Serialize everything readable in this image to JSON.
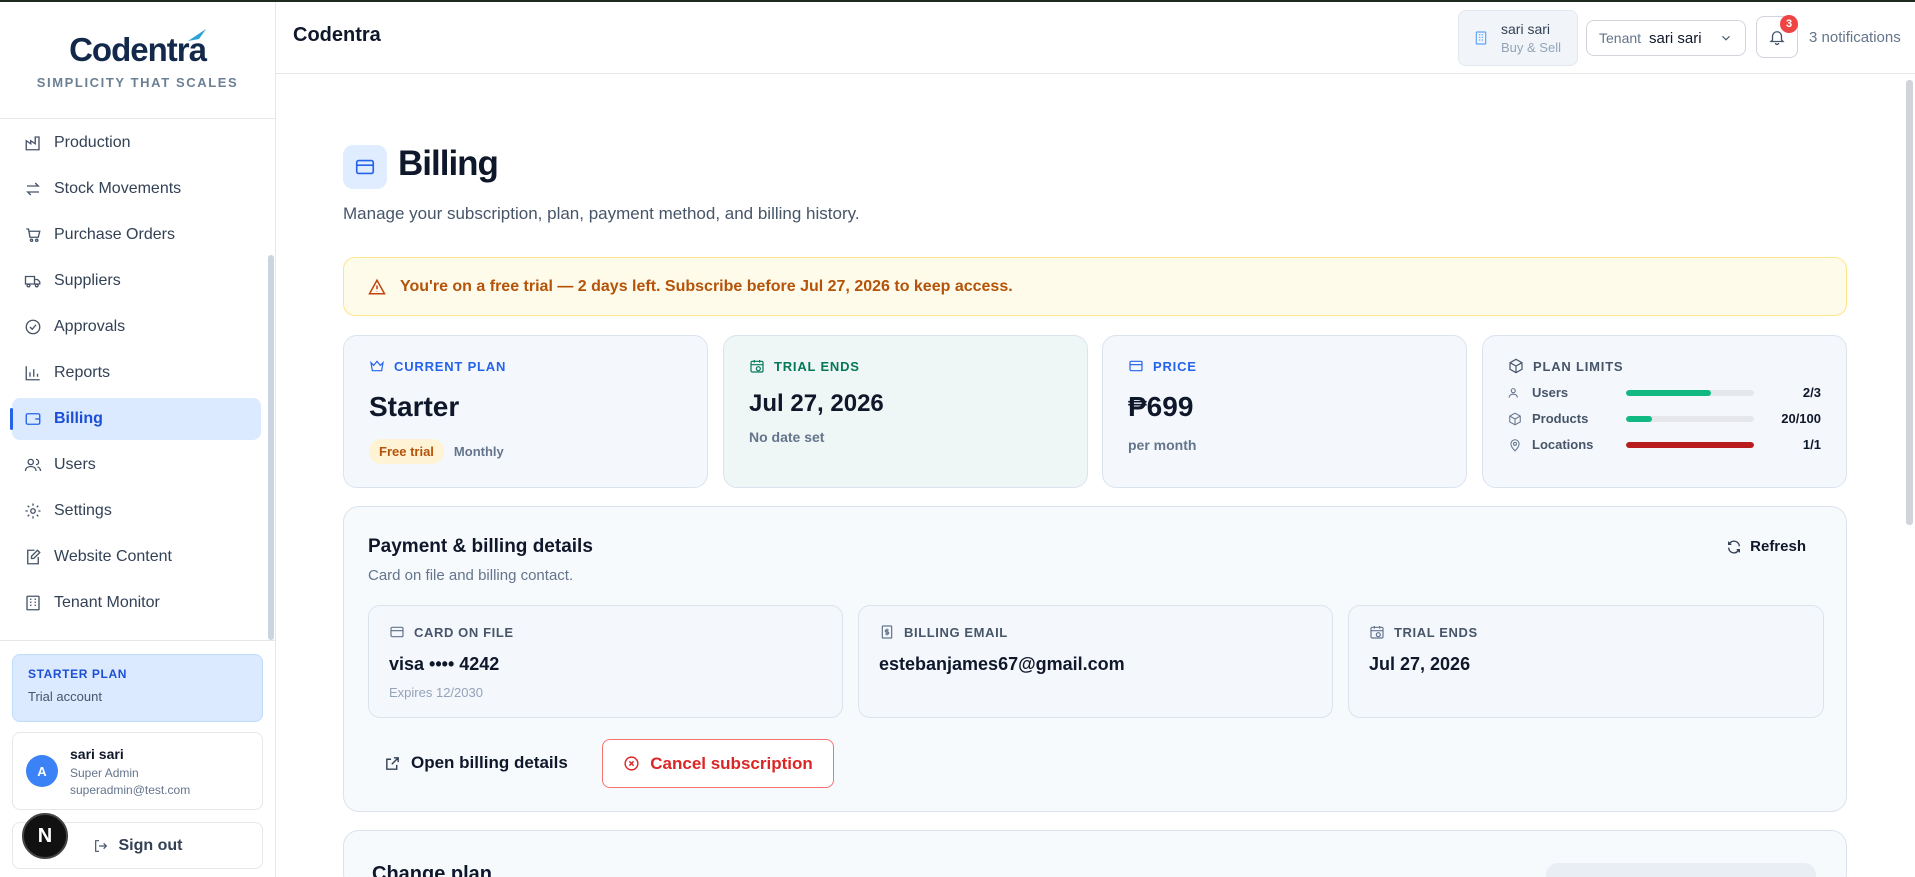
{
  "brand": {
    "logo_text": "Codentra",
    "tagline": "SIMPLICITY THAT SCALES"
  },
  "sidebar": {
    "items": [
      {
        "label": "Production",
        "icon": "factory-icon"
      },
      {
        "label": "Stock Movements",
        "icon": "arrows-icon"
      },
      {
        "label": "Purchase Orders",
        "icon": "cart-icon"
      },
      {
        "label": "Suppliers",
        "icon": "truck-icon"
      },
      {
        "label": "Approvals",
        "icon": "check-circle-icon"
      },
      {
        "label": "Reports",
        "icon": "bar-chart-icon"
      },
      {
        "label": "Billing",
        "icon": "wallet-icon",
        "active": true
      },
      {
        "label": "Users",
        "icon": "users-icon"
      },
      {
        "label": "Settings",
        "icon": "gear-icon"
      },
      {
        "label": "Website Content",
        "icon": "edit-icon"
      },
      {
        "label": "Tenant Monitor",
        "icon": "building-icon"
      }
    ],
    "plan": {
      "title": "STARTER PLAN",
      "subtitle": "Trial account"
    },
    "user": {
      "initial": "A",
      "name": "sari sari",
      "role": "Super Admin",
      "email": "superadmin@test.com"
    },
    "signout_label": "Sign out",
    "floating_badge": "N"
  },
  "header": {
    "title": "Codentra",
    "store": {
      "name": "sari sari",
      "type": "Buy & Sell"
    },
    "tenant": {
      "label": "Tenant",
      "value": "sari sari"
    },
    "notifications": {
      "count": "3",
      "text": "3 notifications"
    }
  },
  "page": {
    "title": "Billing",
    "subtitle": "Manage your subscription, plan, payment method, and billing history.",
    "alert": "You're on a free trial — 2 days left. Subscribe before Jul 27, 2026 to keep access."
  },
  "cards": {
    "current_plan": {
      "label": "CURRENT PLAN",
      "value": "Starter",
      "tag": "Free trial",
      "cycle": "Monthly"
    },
    "trial_ends": {
      "label": "TRIAL ENDS",
      "value": "Jul 27, 2026",
      "note": "No date set"
    },
    "price": {
      "label": "PRICE",
      "value": "₱699",
      "note": "per month"
    },
    "plan_limits": {
      "label": "PLAN LIMITS",
      "rows": [
        {
          "name": "Users",
          "value": "2/3",
          "fraction": 0.667,
          "color": "#10b981"
        },
        {
          "name": "Products",
          "value": "20/100",
          "fraction": 0.2,
          "color": "#10b981"
        },
        {
          "name": "Locations",
          "value": "1/1",
          "fraction": 1.0,
          "color": "#b91c1c"
        }
      ]
    }
  },
  "payment": {
    "title": "Payment & billing details",
    "subtitle": "Card on file and billing contact.",
    "refresh_label": "Refresh",
    "card_on_file": {
      "label": "CARD ON FILE",
      "value": "visa •••• 4242",
      "expires": "Expires 12/2030"
    },
    "billing_email": {
      "label": "BILLING EMAIL",
      "value": "estebanjames67@gmail.com"
    },
    "trial_ends": {
      "label": "TRIAL ENDS",
      "value": "Jul 27, 2026"
    },
    "open_label": "Open billing details",
    "cancel_label": "Cancel subscription"
  },
  "change_plan": {
    "title": "Change plan"
  },
  "colors": {
    "accent": "#2563eb",
    "danger": "#dc2626",
    "success": "#10b981",
    "warning": "#b45309"
  }
}
